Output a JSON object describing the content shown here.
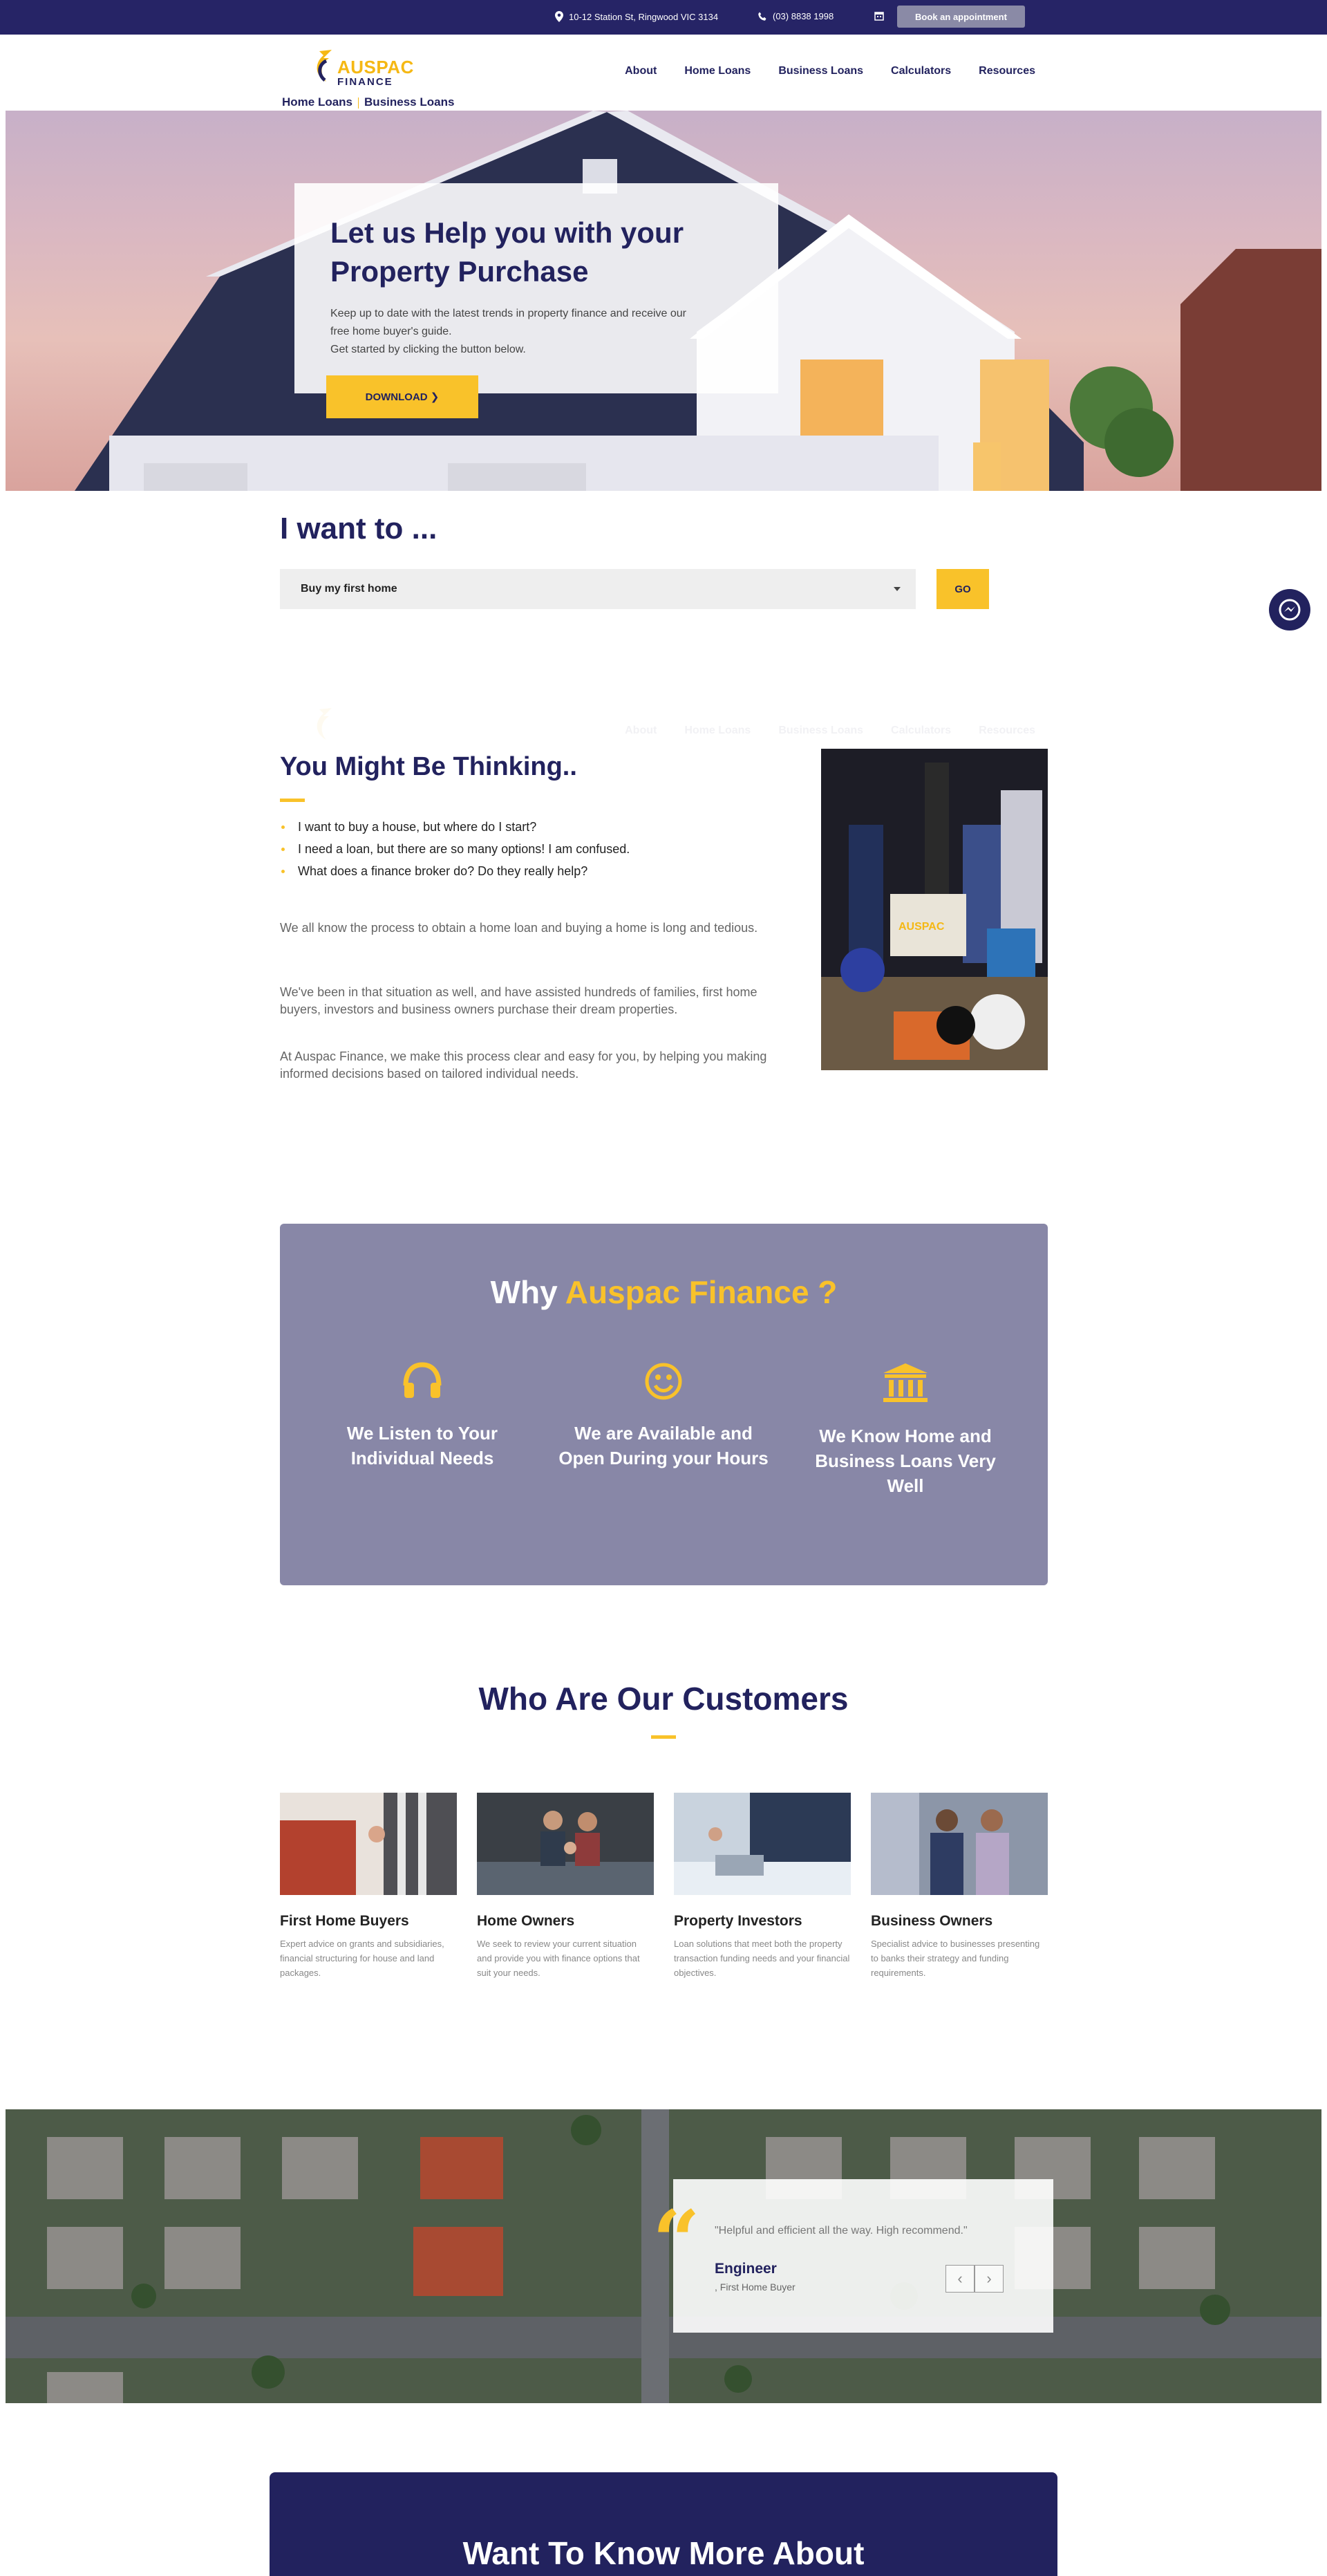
{
  "topbar": {
    "address": "10-12 Station St, Ringwood VIC 3134",
    "phone": "(03) 8838 1998",
    "book_label": "Book an appointment"
  },
  "brand": {
    "name": "AUSPAC",
    "sub": "FINANCE",
    "link_home": "Home Loans",
    "link_business": "Business Loans"
  },
  "nav": {
    "items": [
      "About",
      "Home Loans",
      "Business Loans",
      "Calculators",
      "Resources"
    ]
  },
  "hero": {
    "title_line1": "Let us Help you with your",
    "title_line2": "Property Purchase",
    "text_line1": "Keep up to date with the latest trends in property finance and receive our",
    "text_line2": "free home buyer's guide.",
    "text_line3": "Get started by clicking the button below.",
    "button_label": "DOWNLOAD ❯"
  },
  "iwant": {
    "title": "I want to ...",
    "selected": "Buy my first home",
    "go_label": "GO"
  },
  "thinking": {
    "title": "You Might Be Thinking..",
    "bullets": [
      "I want to buy a house, but where do I start?",
      "I need a loan, but there are so many options! I am confused.",
      "What does a finance broker do? Do they really help?"
    ],
    "paragraphs": [
      "We all know the process to obtain a home loan and buying a home is long and tedious.",
      "We've been in that situation as well, and have assisted hundreds of families, first home buyers, investors and business owners purchase their dream properties.",
      "At Auspac Finance, we make this process clear and easy for you, by helping you making informed decisions based on tailored individual needs."
    ]
  },
  "why": {
    "title_prefix": "Why ",
    "title_accent": "Auspac Finance ?",
    "columns": [
      {
        "icon": "headphones-icon",
        "label": "We Listen to Your Individual Needs"
      },
      {
        "icon": "smiley-icon",
        "label": "We are Available and Open During your Hours"
      },
      {
        "icon": "bank-icon",
        "label": "We Know Home and Business Loans Very Well"
      }
    ]
  },
  "customers": {
    "title": "Who Are Our Customers",
    "cards": [
      {
        "name": "First Home Buyers",
        "desc": "Expert advice on grants and subsidiaries, financial structuring for house and land packages."
      },
      {
        "name": "Home Owners",
        "desc": "We seek to review your current situation and provide you with finance options that suit your needs."
      },
      {
        "name": "Property Investors",
        "desc": "Loan solutions that meet both the property transaction funding needs and your financial objectives."
      },
      {
        "name": "Business Owners",
        "desc": "Specialist advice to businesses presenting to banks their strategy and funding requirements."
      }
    ]
  },
  "testimonial": {
    "quote": "\"Helpful and efficient all the way. High recommend.\"",
    "name": "Engineer",
    "role": ", First Home Buyer",
    "prev": "‹",
    "next": "›"
  },
  "cta": {
    "title": "Want To Know More About"
  },
  "colors": {
    "navy": "#262466",
    "accent": "#f9c22a",
    "why_bg": "#8887a7"
  }
}
